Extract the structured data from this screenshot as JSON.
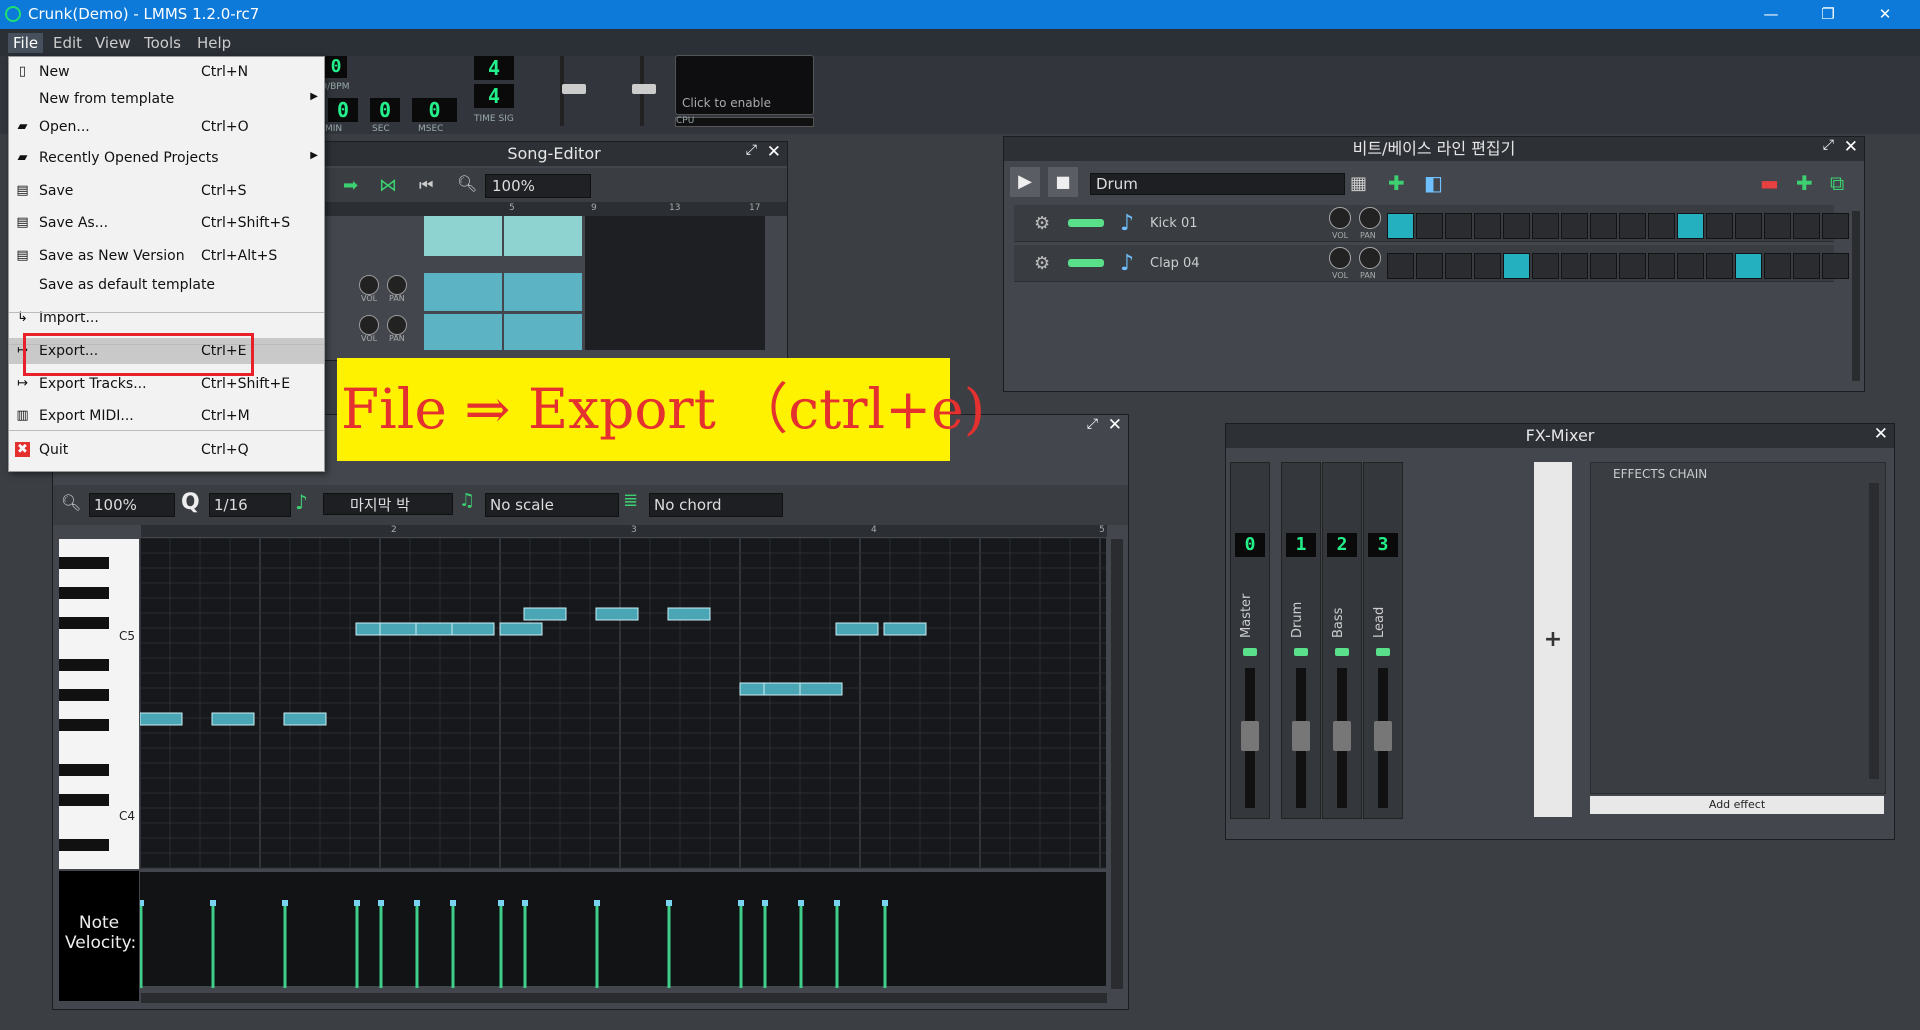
{
  "window": {
    "title": "Crunk(Demo) - LMMS 1.2.0-rc7",
    "minimize": "—",
    "restore": "❐",
    "close": "✕"
  },
  "menubar": [
    "File",
    "Edit",
    "View",
    "Tools",
    "Help"
  ],
  "toolbar": {
    "tempo": "0",
    "tempo_label": "O/BPM",
    "timesig_top": "4",
    "timesig_bottom": "4",
    "timesig_label": "TIME SIG",
    "time_min": "0",
    "time_sec": "0",
    "time_msec": "0",
    "label_min": "MIN",
    "label_sec": "SEC",
    "label_msec": "MSEC",
    "cpu_hint": "Click to enable",
    "cpu_label": "CPU"
  },
  "file_menu": {
    "items": [
      {
        "label": "New",
        "shortcut": "Ctrl+N",
        "icon": "document-icon"
      },
      {
        "label": "New from template",
        "shortcut": "",
        "submenu": true
      },
      {
        "label": "Open...",
        "shortcut": "Ctrl+O",
        "icon": "folder-icon"
      },
      {
        "label": "Recently Opened Projects",
        "shortcut": "",
        "submenu": true,
        "icon": "folder-icon"
      },
      {
        "label": "Save",
        "shortcut": "Ctrl+S",
        "icon": "save-icon"
      },
      {
        "label": "Save As...",
        "shortcut": "Ctrl+Shift+S",
        "icon": "save-icon"
      },
      {
        "label": "Save as New Version",
        "shortcut": "Ctrl+Alt+S",
        "icon": "save-icon"
      },
      {
        "label": "Save as default template",
        "shortcut": ""
      },
      {
        "label": "Import...",
        "shortcut": "",
        "icon": "import-icon"
      },
      {
        "label": "Export...",
        "shortcut": "Ctrl+E",
        "icon": "export-icon",
        "highlighted": true
      },
      {
        "label": "Export Tracks...",
        "shortcut": "Ctrl+Shift+E",
        "icon": "export-icon"
      },
      {
        "label": "Export MIDI...",
        "shortcut": "Ctrl+M",
        "icon": "midi-icon"
      },
      {
        "label": "Quit",
        "shortcut": "Ctrl+Q",
        "icon": "quit-icon"
      }
    ]
  },
  "song_editor": {
    "title": "Song-Editor",
    "zoom": "100%",
    "bar_labels": [
      "5",
      "9",
      "13",
      "17"
    ],
    "vol": "VOL",
    "pan": "PAN"
  },
  "beat_editor": {
    "title": "비트/베이스 라인 편집기",
    "pattern": "Drum",
    "tracks": [
      {
        "name": "Kick 01",
        "steps": [
          1,
          0,
          0,
          0,
          0,
          0,
          0,
          0,
          0,
          0,
          1,
          0,
          0,
          0,
          0,
          0
        ]
      },
      {
        "name": "Clap 04",
        "steps": [
          0,
          0,
          0,
          0,
          1,
          0,
          0,
          0,
          0,
          0,
          0,
          0,
          1,
          0,
          0,
          0
        ]
      }
    ],
    "vol": "VOL",
    "pan": "PAN"
  },
  "fx_mixer": {
    "title": "FX-Mixer",
    "channels": [
      {
        "name": "Master",
        "number": "0"
      },
      {
        "name": "Drum",
        "number": "1"
      },
      {
        "name": "Bass",
        "number": "2"
      },
      {
        "name": "Lead",
        "number": "3"
      }
    ],
    "add_channel": "+",
    "effects_chain": "EFFECTS CHAIN",
    "add_effect": "Add effect"
  },
  "piano_roll": {
    "zoom": "100%",
    "quantize": "1/16",
    "note_length": "마지막 박",
    "scale": "No scale",
    "chord": "No chord",
    "key_labels": [
      "C5",
      "C4"
    ],
    "bar_labels": [
      "2",
      "3",
      "4",
      "5"
    ],
    "velocity_label": "Note Velocity:",
    "notes": [
      {
        "start": 0.0,
        "row": 9
      },
      {
        "start": 1.2,
        "row": 9
      },
      {
        "start": 2.4,
        "row": 9
      },
      {
        "start": 3.6,
        "row": 3
      },
      {
        "start": 4.0,
        "row": 3
      },
      {
        "start": 4.6,
        "row": 3
      },
      {
        "start": 5.2,
        "row": 3
      },
      {
        "start": 6.0,
        "row": 3
      },
      {
        "start": 6.4,
        "row": 2
      },
      {
        "start": 7.6,
        "row": 2
      },
      {
        "start": 8.8,
        "row": 2
      },
      {
        "start": 10.0,
        "row": 7
      },
      {
        "start": 10.4,
        "row": 7
      },
      {
        "start": 11.0,
        "row": 7
      },
      {
        "start": 11.6,
        "row": 3
      },
      {
        "start": 12.4,
        "row": 3
      }
    ]
  },
  "overlay": {
    "text": "File ⇒ Export （ctrl+e)"
  }
}
